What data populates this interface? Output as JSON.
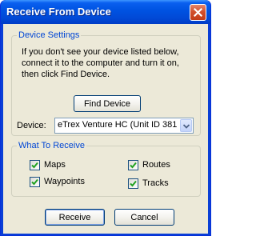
{
  "window": {
    "title": "Receive From Device",
    "close_label": "✕"
  },
  "device_settings": {
    "legend": "Device Settings",
    "instructions": [
      "If you don't see your device listed below,",
      "connect it to the computer and turn it on,",
      "then click Find Device."
    ],
    "find_button": "Find Device",
    "device_label": "Device:",
    "device_value": "eTrex Venture HC (Unit ID 381"
  },
  "what_to_receive": {
    "legend": "What To Receive",
    "items": [
      {
        "label": "Maps",
        "checked": true
      },
      {
        "label": "Routes",
        "checked": true
      },
      {
        "label": "Waypoints",
        "checked": true
      },
      {
        "label": "Tracks",
        "checked": true
      }
    ]
  },
  "footer": {
    "receive_button": "Receive",
    "cancel_button": "Cancel"
  },
  "colors": {
    "titlebar": "#0054e3",
    "dialog_bg": "#ece9d8",
    "group_legend": "#0046d5",
    "check_mark": "#21a121"
  },
  "icons": {
    "close": "close-icon",
    "dropdown": "chevron-down-icon",
    "check": "check-icon"
  }
}
